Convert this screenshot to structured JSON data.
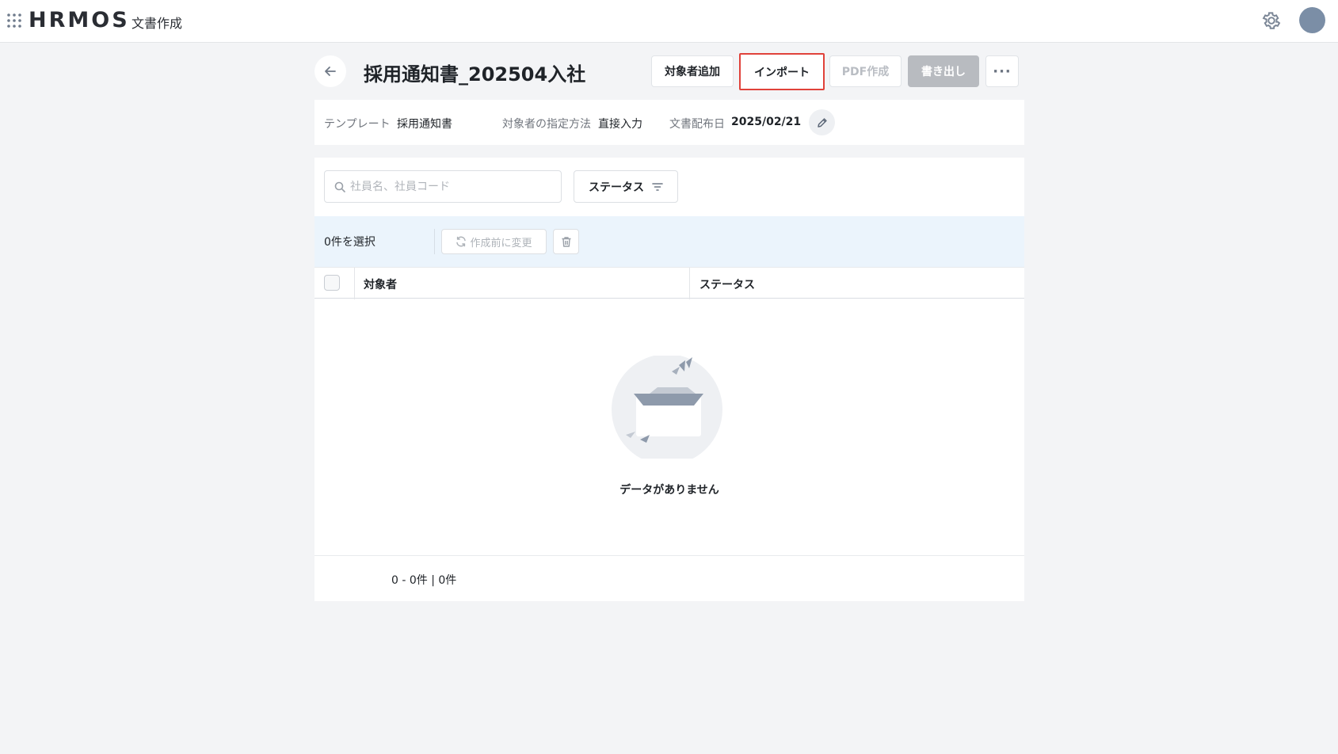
{
  "header": {
    "logo_text": "HRMOS",
    "app_name": "文書作成",
    "icons": [
      "apps-grid-icon",
      "gear-icon",
      "avatar"
    ],
    "colors": {
      "avatar": "#7b8ea6"
    }
  },
  "page": {
    "title": "採用通知書_202504入社",
    "buttons": {
      "add_target": "対象者追加",
      "import": "インポート",
      "pdf_create": "PDF作成",
      "export": "書き出し",
      "more": "···"
    }
  },
  "info": {
    "template_label": "テンプレート",
    "template_value": "採用通知書",
    "method_label": "対象者の指定方法",
    "method_value": "直接入力",
    "date_label": "文書配布日",
    "date_value": "2025/02/21"
  },
  "filters": {
    "search_placeholder": "社員名、社員コード",
    "search_value": "",
    "status_label": "ステータス"
  },
  "selection": {
    "count_text": "0件を選択",
    "change_label": "作成前に変更"
  },
  "table": {
    "columns": [
      "対象者",
      "ステータス"
    ],
    "rows": [],
    "empty_text": "データがありません"
  },
  "pagination": {
    "text": "0 - 0件 | 0件"
  },
  "highlight": {
    "color": "#e0423a"
  }
}
